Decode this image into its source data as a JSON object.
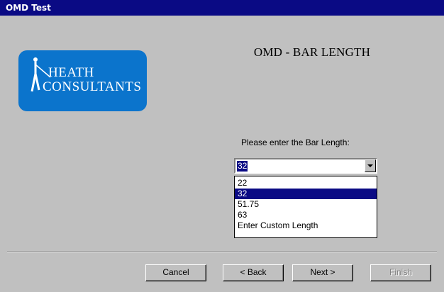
{
  "window": {
    "title": "OMD Test"
  },
  "logo": {
    "line1": "Heath",
    "line2": "Consultants"
  },
  "page": {
    "heading": "OMD - BAR LENGTH",
    "prompt": "Please enter the Bar Length:"
  },
  "combo": {
    "value": "32",
    "options": [
      "22",
      "32",
      "51.75",
      "63",
      "Enter Custom Length"
    ],
    "selected_index": 1
  },
  "buttons": {
    "cancel": "Cancel",
    "back": "< Back",
    "next": "Next >",
    "finish": "Finish"
  }
}
